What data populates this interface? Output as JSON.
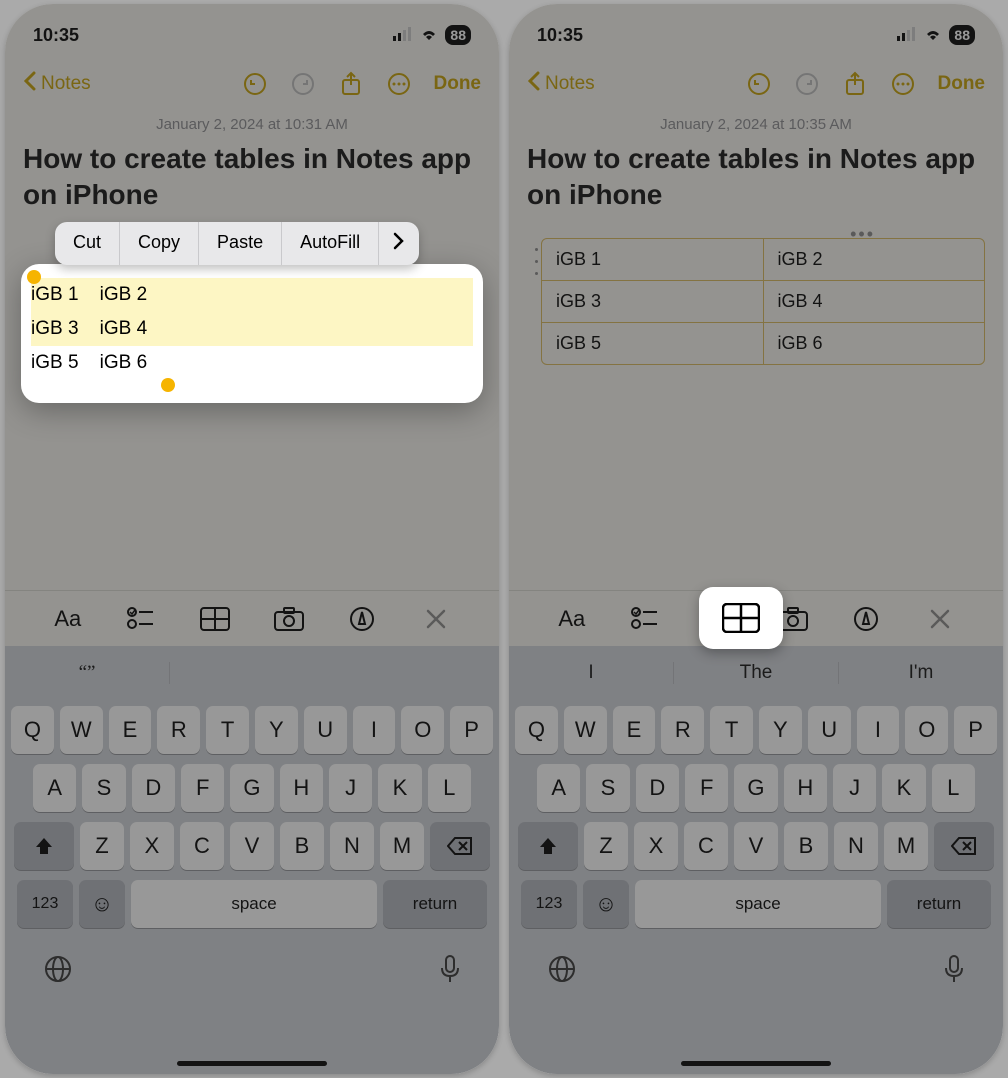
{
  "left": {
    "status": {
      "time": "10:35",
      "battery": "88"
    },
    "nav": {
      "back": "Notes",
      "done": "Done"
    },
    "date": "January 2, 2024 at 10:31 AM",
    "title": "How to create tables in Notes app on iPhone",
    "context_menu": [
      "Cut",
      "Copy",
      "Paste",
      "AutoFill"
    ],
    "body_rows": [
      [
        "iGB 1",
        "iGB 2"
      ],
      [
        "iGB 3",
        "iGB 4"
      ],
      [
        "iGB 5",
        "iGB 6"
      ]
    ],
    "keyboard": {
      "suggestions": [
        "",
        "",
        ""
      ],
      "rows": [
        [
          "Q",
          "W",
          "E",
          "R",
          "T",
          "Y",
          "U",
          "I",
          "O",
          "P"
        ],
        [
          "A",
          "S",
          "D",
          "F",
          "G",
          "H",
          "J",
          "K",
          "L"
        ],
        [
          "Z",
          "X",
          "C",
          "V",
          "B",
          "N",
          "M"
        ]
      ],
      "num": "123",
      "space": "space",
      "ret": "return"
    }
  },
  "right": {
    "status": {
      "time": "10:35",
      "battery": "88"
    },
    "nav": {
      "back": "Notes",
      "done": "Done"
    },
    "date": "January 2, 2024 at 10:35 AM",
    "title": "How to create tables in Notes app on iPhone",
    "table": [
      [
        "iGB 1",
        "iGB 2"
      ],
      [
        "iGB 3",
        "iGB 4"
      ],
      [
        "iGB 5",
        "iGB 6"
      ]
    ],
    "keyboard": {
      "suggestions": [
        "I",
        "The",
        "I'm"
      ],
      "rows": [
        [
          "Q",
          "W",
          "E",
          "R",
          "T",
          "Y",
          "U",
          "I",
          "O",
          "P"
        ],
        [
          "A",
          "S",
          "D",
          "F",
          "G",
          "H",
          "J",
          "K",
          "L"
        ],
        [
          "Z",
          "X",
          "C",
          "V",
          "B",
          "N",
          "M"
        ]
      ],
      "num": "123",
      "space": "space",
      "ret": "return"
    }
  },
  "colors": {
    "accent": "#c6a000"
  }
}
